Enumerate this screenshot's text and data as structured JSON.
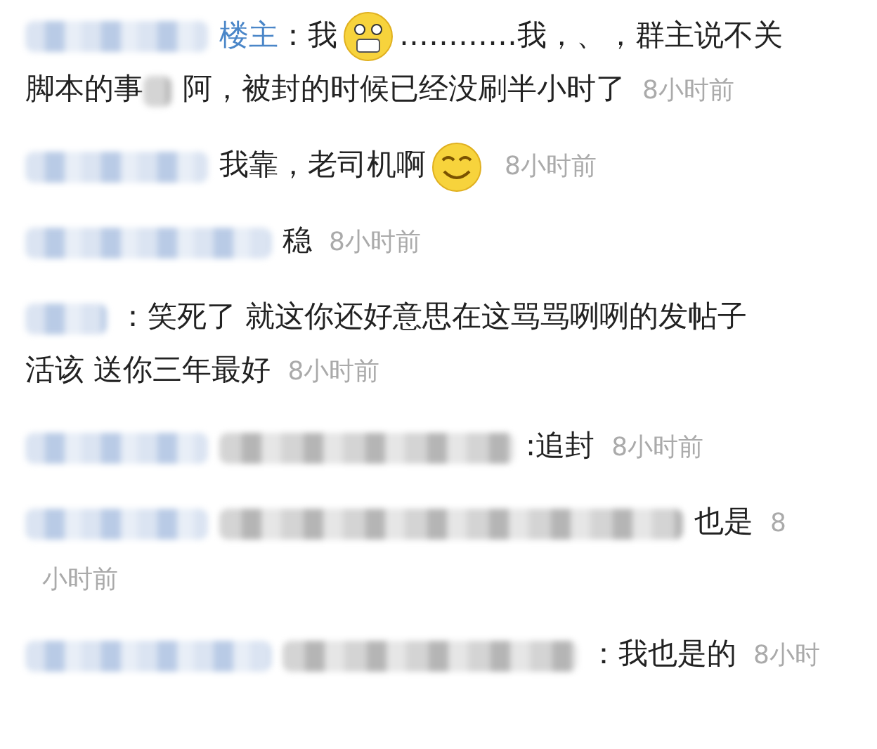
{
  "comments": [
    {
      "segments": [
        {
          "kind": "name_blur"
        },
        {
          "kind": "role",
          "text": "楼主"
        },
        {
          "kind": "text",
          "text": "：我"
        },
        {
          "kind": "emoji_scared"
        },
        {
          "kind": "text",
          "text": "…………我，、，群主说不关"
        },
        {
          "kind": "break"
        },
        {
          "kind": "text",
          "text": "脚本的事"
        },
        {
          "kind": "blur_char"
        },
        {
          "kind": "text",
          "text": "阿，被封的时候已经没刷半小时了"
        },
        {
          "kind": "time",
          "text": "8小时前"
        }
      ]
    },
    {
      "segments": [
        {
          "kind": "name_blur"
        },
        {
          "kind": "text",
          "text": "我靠，老司机啊"
        },
        {
          "kind": "emoji_smile"
        },
        {
          "kind": "time",
          "text": "8小时前"
        }
      ]
    },
    {
      "segments": [
        {
          "kind": "name_blur_long"
        },
        {
          "kind": "text",
          "text": "稳"
        },
        {
          "kind": "time",
          "text": "8小时前"
        }
      ]
    },
    {
      "segments": [
        {
          "kind": "name_blur_short"
        },
        {
          "kind": "text",
          "text": "：笑死了 就这你还好意思在这骂骂咧咧的发帖子"
        },
        {
          "kind": "break"
        },
        {
          "kind": "text",
          "text": "活该 送你三年最好"
        },
        {
          "kind": "time",
          "text": "8小时前"
        }
      ]
    },
    {
      "segments": [
        {
          "kind": "name_blur"
        },
        {
          "kind": "blur"
        },
        {
          "kind": "text",
          "text": ":追封"
        },
        {
          "kind": "time",
          "text": "8小时前"
        }
      ]
    },
    {
      "segments": [
        {
          "kind": "name_blur"
        },
        {
          "kind": "blur_long"
        },
        {
          "kind": "text",
          "text": "也是"
        },
        {
          "kind": "time",
          "text": "8"
        },
        {
          "kind": "break"
        },
        {
          "kind": "time_wrapped",
          "text": "小时前"
        }
      ]
    },
    {
      "segments": [
        {
          "kind": "name_blur_long"
        },
        {
          "kind": "blur"
        },
        {
          "kind": "text",
          "text": "：我也是的"
        },
        {
          "kind": "time",
          "text": "8小时"
        }
      ]
    }
  ]
}
